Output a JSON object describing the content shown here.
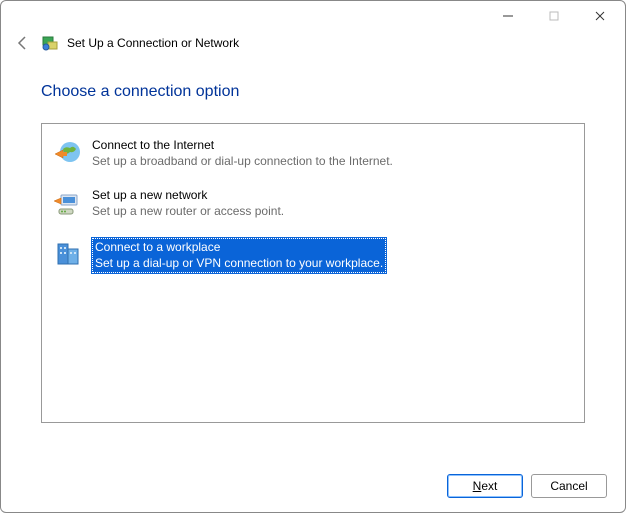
{
  "window": {
    "title": "Set Up a Connection or Network"
  },
  "heading": "Choose a connection option",
  "options": [
    {
      "title": "Connect to the Internet",
      "desc": "Set up a broadband or dial-up connection to the Internet.",
      "selected": false
    },
    {
      "title": "Set up a new network",
      "desc": "Set up a new router or access point.",
      "selected": false
    },
    {
      "title": "Connect to a workplace",
      "desc": "Set up a dial-up or VPN connection to your workplace.",
      "selected": true
    }
  ],
  "buttons": {
    "next_prefix": "N",
    "next_rest": "ext",
    "cancel": "Cancel"
  }
}
